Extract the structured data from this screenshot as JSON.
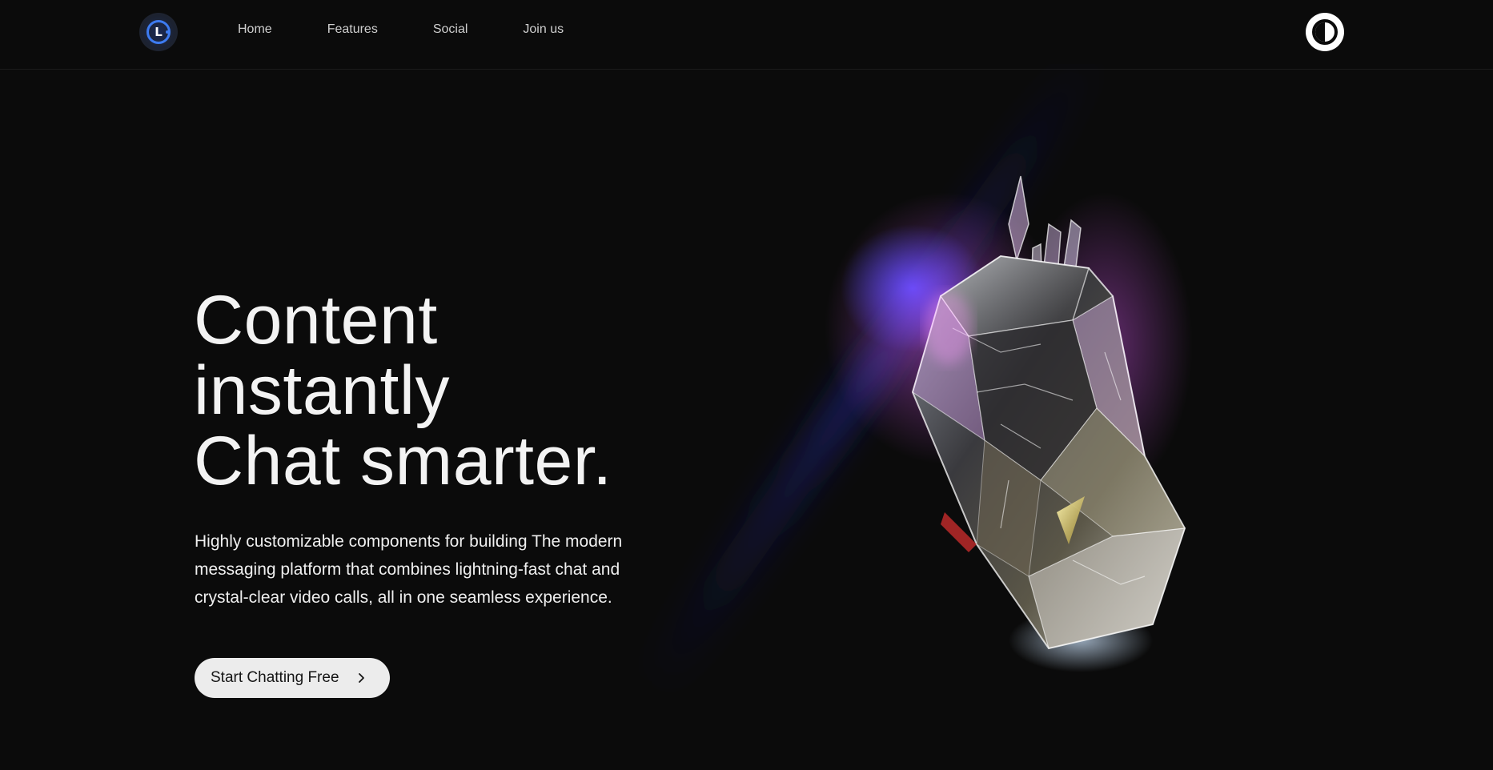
{
  "nav": {
    "logo_letter": "L",
    "links": [
      {
        "label": "Home"
      },
      {
        "label": "Features"
      },
      {
        "label": "Social"
      },
      {
        "label": "Join us"
      }
    ]
  },
  "hero": {
    "title_lines": [
      "Content",
      "instantly",
      "Chat smarter."
    ],
    "description": "Highly customizable components for building The modern messaging platform that combines lightning-fast chat and crystal-clear video calls, all in one seamless experience.",
    "cta_label": "Start Chatting Free"
  },
  "icons": {
    "cta": "chevron-right-icon",
    "theme": "half-circle-icon",
    "logo": "logo-icon"
  },
  "colors": {
    "background": "#0b0b0b",
    "accent_blue": "#3d7bf0",
    "glow_pink": "#e35cff",
    "cta_bg": "#ececec"
  }
}
